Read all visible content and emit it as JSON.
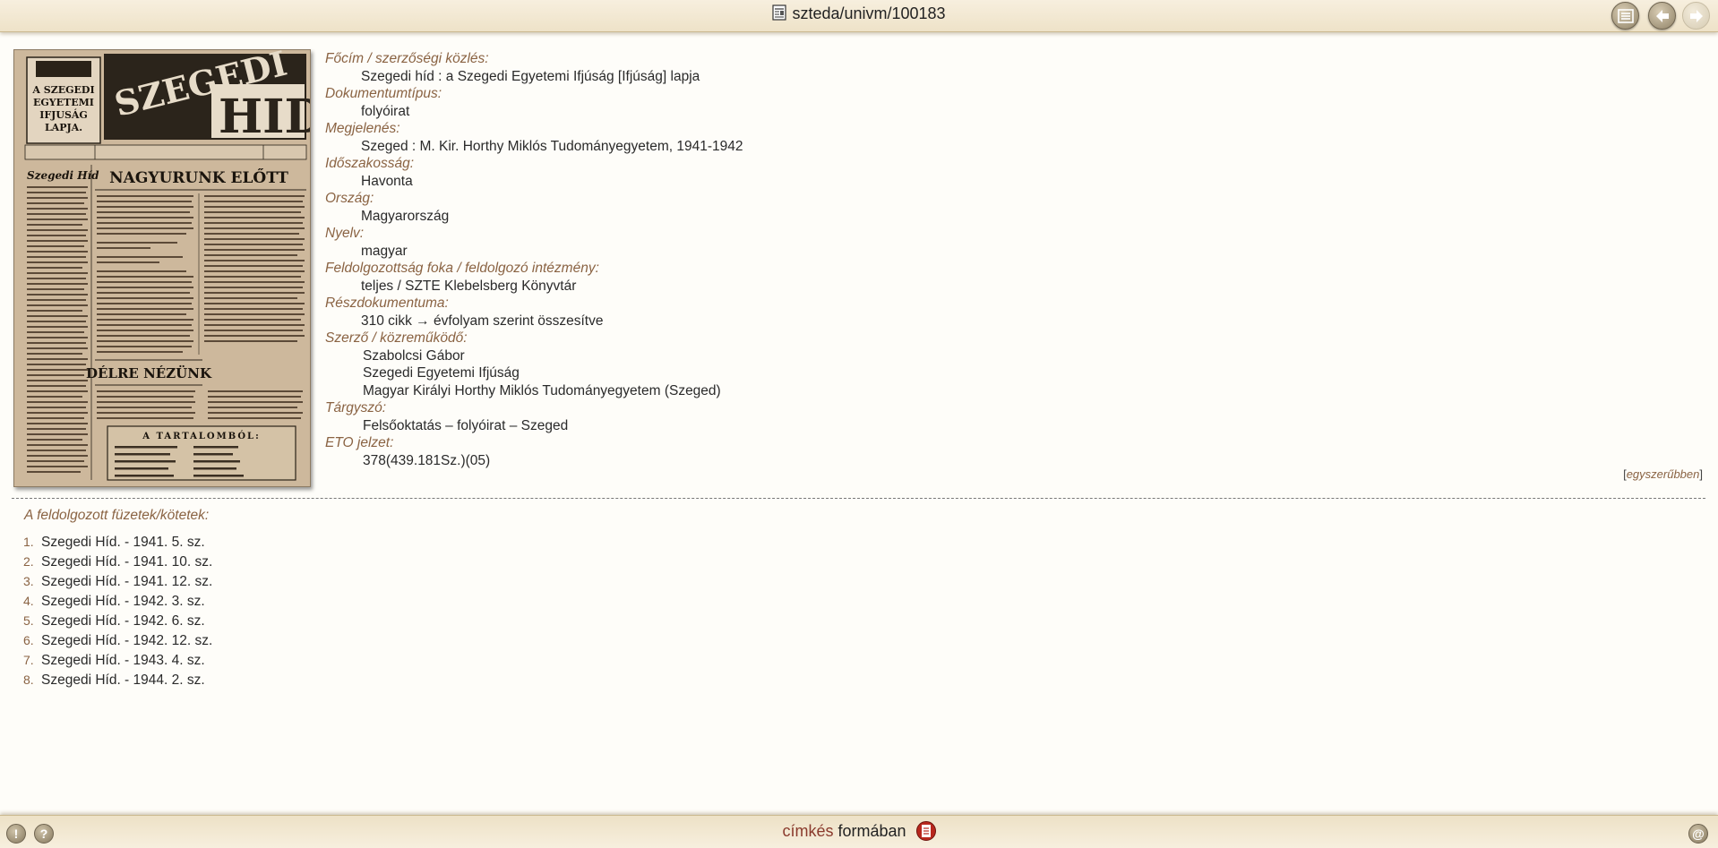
{
  "header": {
    "title": "szteda/univm/100183"
  },
  "cover": {
    "masthead_left": [
      "A SZEGEDI",
      "EGYETEMI",
      "IFJUSÁG",
      "LAPJA."
    ],
    "masthead_title_1": "SZEGEDI",
    "masthead_title_2": "HID",
    "column_head": "Szegedi Híd",
    "headline_1": "NAGYURUNK ELŐTT",
    "headline_2": "DÉLRE NÉZÜNK",
    "contents_head": "A TARTALOMBÓL:"
  },
  "record": {
    "fields": [
      {
        "label": "Főcím / szerzőségi közlés:",
        "values": [
          "Szegedi híd : a Szegedi Egyetemi Ifjúság [Ifjúság] lapja"
        ]
      },
      {
        "label": "Dokumentumtípus:",
        "values": [
          "folyóirat"
        ]
      },
      {
        "label": "Megjelenés:",
        "values": [
          "Szeged : M. Kir. Horthy Miklós Tudományegyetem, 1941-1942"
        ]
      },
      {
        "label": "Időszakosság:",
        "values": [
          "Havonta"
        ]
      },
      {
        "label": "Ország:",
        "values": [
          "Magyarország"
        ]
      },
      {
        "label": "Nyelv:",
        "values": [
          "magyar"
        ]
      },
      {
        "label": "Feldolgozottság foka / feldolgozó intézmény:",
        "values": [
          "teljes / SZTE Klebelsberg Könyvtár"
        ]
      },
      {
        "label": "Részdokumentuma:",
        "values": [
          "310 cikk → évfolyam szerint összesítve"
        ]
      },
      {
        "label": "Szerző / közreműködő:",
        "values": [
          "Szabolcsi Gábor",
          "Szegedi Egyetemi Ifjúság",
          "Magyar Királyi Horthy Miklós Tudományegyetem (Szeged)"
        ]
      },
      {
        "label": "Tárgyszó:",
        "values": [
          "Felsőoktatás – folyóirat – Szeged"
        ]
      },
      {
        "label": "ETO jelzet:",
        "values": [
          "378(439.181Sz.)(05)"
        ]
      }
    ]
  },
  "simpler": {
    "open": "[",
    "link": "egyszerűbben",
    "close": "]"
  },
  "volumes": {
    "title": "A feldolgozott füzetek/kötetek:",
    "items": [
      {
        "num": "1.",
        "text": "Szegedi Híd. - 1941. 5. sz."
      },
      {
        "num": "2.",
        "text": "Szegedi Híd. - 1941. 10. sz."
      },
      {
        "num": "3.",
        "text": "Szegedi Híd. - 1941. 12. sz."
      },
      {
        "num": "4.",
        "text": "Szegedi Híd. - 1942. 3. sz."
      },
      {
        "num": "5.",
        "text": "Szegedi Híd. - 1942. 6. sz."
      },
      {
        "num": "6.",
        "text": "Szegedi Híd. - 1942. 12. sz."
      },
      {
        "num": "7.",
        "text": "Szegedi Híd. - 1943. 4. sz."
      },
      {
        "num": "8.",
        "text": "Szegedi Híd. - 1944. 2. sz."
      }
    ]
  },
  "footer": {
    "format_word_1": "címkés",
    "format_word_2": "formában",
    "alert_glyph": "!",
    "help_glyph": "?",
    "email_glyph": "@"
  },
  "icons": {
    "title_doc": "document-icon",
    "list": "list-icon",
    "back": "arrow-left-icon",
    "forward": "arrow-right-icon",
    "pdf": "pdf-icon"
  },
  "colors": {
    "label": "#8a6343",
    "bar": "#f3e9d3",
    "accent": "#8a3a2c"
  }
}
